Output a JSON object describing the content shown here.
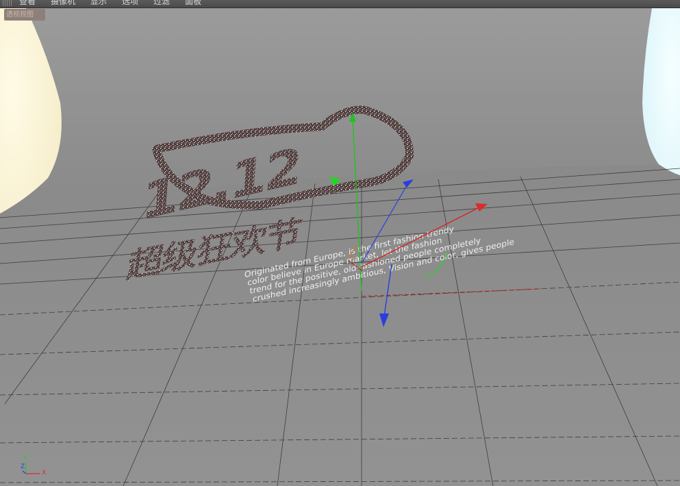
{
  "menubar": {
    "items": [
      {
        "label": "查看"
      },
      {
        "label": "摄像机"
      },
      {
        "label": "显示"
      },
      {
        "label": "选项"
      },
      {
        "label": "过滤"
      },
      {
        "label": "面板"
      }
    ]
  },
  "viewport": {
    "camera_label": "透视视图",
    "logo_numerals": "12.12",
    "logo_chinese": "超级狂欢节",
    "body_text": [
      "Originated from Europe, is the first fashion trendy",
      "color believe in Europe market, let the fashion",
      "trend for the positive, old-fashioned people completely",
      "crushed increasingly ambitious, Vision and color, gives people"
    ]
  },
  "axis_indicator": {
    "y_label": "Y",
    "z_label": "Z",
    "x_label": "X"
  },
  "colors": {
    "backdrop_gray": "#8a8a8a",
    "floor_gray": "#8e8e8e",
    "grid_line": "#3a3a3a",
    "x_axis": "#e02a2a",
    "y_axis": "#22cc22",
    "z_axis": "#2a3ee0",
    "light_left": "#fff9dc",
    "light_right": "#eefcff",
    "logo_fill": "#5a4646",
    "logo_speckle": "#e8d8d8"
  }
}
